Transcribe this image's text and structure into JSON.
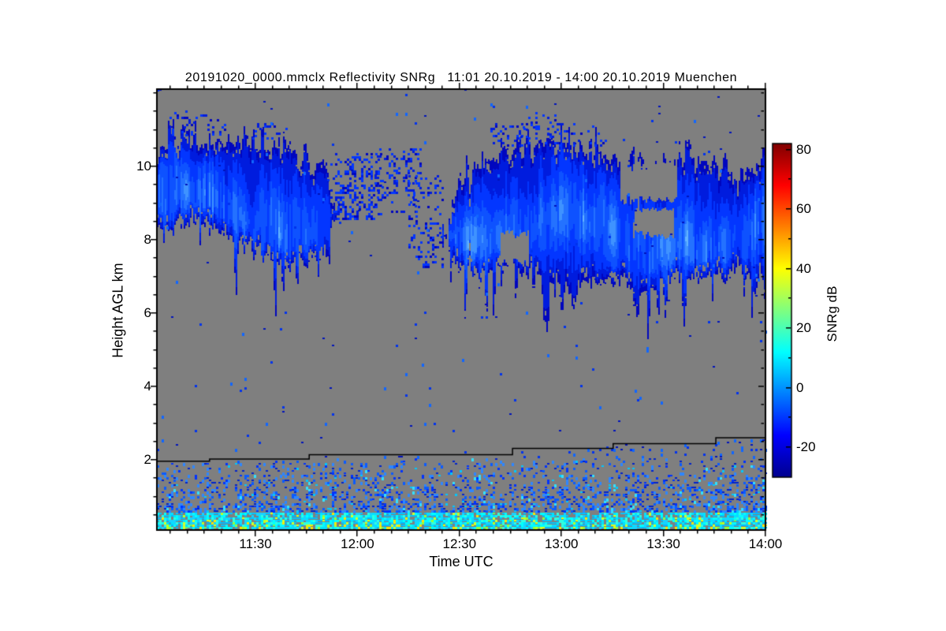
{
  "chart_data": {
    "type": "heatmap",
    "title": "20191020_0000.mmclx Reflectivity SNRg   11:01 20.10.2019 - 14:00 20.10.2019 Muenchen",
    "xlabel": "Time UTC",
    "ylabel": "Height AGL km",
    "x_axis": {
      "start_time": "11:01",
      "end_time": "14:00",
      "total_minutes": 179,
      "tick_labels": [
        "11:30",
        "12:00",
        "12:30",
        "13:00",
        "13:30",
        "14:00"
      ],
      "tick_minutes": [
        29,
        59,
        89,
        119,
        149,
        179
      ],
      "minor_tick_step_min": 5
    },
    "y_axis": {
      "range_km": [
        0.09,
        12.11
      ],
      "tick_labels": [
        "2",
        "4",
        "6",
        "8",
        "10"
      ],
      "tick_values_km": [
        2,
        4,
        6,
        8,
        10
      ],
      "minor_tick_step_km": 0.5
    },
    "colorbar": {
      "label": "SNRg dB",
      "range_db": [
        -30,
        82
      ],
      "tick_labels": [
        "80",
        "60",
        "40",
        "20",
        "0",
        "-20"
      ],
      "tick_values_db": [
        80,
        60,
        40,
        20,
        0,
        -20
      ],
      "minor_tick_step_db": 10,
      "colormap": "jet",
      "gradient_stops": [
        [
          "#800000",
          0.0
        ],
        [
          "#ff0000",
          0.125
        ],
        [
          "#ffff00",
          0.375
        ],
        [
          "#00ffff",
          0.625
        ],
        [
          "#0000ff",
          0.875
        ],
        [
          "#00008f",
          1.0
        ]
      ]
    },
    "no_data_color": "#7f7f7f",
    "frame_color": "#000000",
    "cloud_palette": [
      "#0006BE",
      "#001CDE",
      "#0336FF",
      "#0E52FF",
      "#2472FF",
      "#3F93FF",
      "#63B4FF",
      "#86CFFF",
      "#A3E2FF"
    ],
    "cloud_bands": [
      {
        "name": "upper-cloud-mass-left",
        "t": [
          0,
          8,
          18,
          27,
          36,
          46,
          53
        ],
        "top_km": [
          10.3,
          10.9,
          10.6,
          10.8,
          10.6,
          10.1,
          9.9
        ],
        "bot_km": [
          8.4,
          8.5,
          8.3,
          7.8,
          7.3,
          7.4,
          8.0
        ],
        "core_km": [
          9.3,
          9.4,
          9.0,
          8.3,
          8.2,
          8.2,
          8.8
        ],
        "intensity": [
          0.9,
          0.95,
          0.8,
          0.9,
          0.95,
          0.8,
          0.45
        ]
      },
      {
        "name": "upper-cloud-mass-right",
        "t": [
          84,
          95,
          105,
          115,
          125,
          135,
          145,
          155,
          165,
          172,
          179
        ],
        "top_km": [
          9.3,
          10.0,
          10.6,
          10.6,
          10.5,
          10.3,
          9.9,
          10.2,
          10.0,
          9.7,
          9.9
        ],
        "bot_km": [
          7.3,
          7.2,
          7.4,
          7.0,
          6.9,
          6.8,
          6.7,
          7.1,
          7.0,
          7.3,
          7.0
        ],
        "core_km": [
          8.1,
          8.0,
          8.2,
          8.6,
          8.9,
          8.3,
          7.6,
          8.0,
          7.6,
          8.2,
          8.6
        ],
        "intensity": [
          0.75,
          0.9,
          0.85,
          0.8,
          0.95,
          0.85,
          0.8,
          0.9,
          0.9,
          0.7,
          0.8
        ]
      }
    ],
    "debris_patches": [
      {
        "t0": 51,
        "t1": 66,
        "h0": 8.6,
        "h1": 10.4,
        "density": 0.3
      },
      {
        "t0": 64,
        "t1": 78,
        "h0": 8.8,
        "h1": 10.5,
        "density": 0.22
      },
      {
        "t0": 74,
        "t1": 84,
        "h0": 7.3,
        "h1": 9.8,
        "density": 0.15
      },
      {
        "t0": 3,
        "t1": 20,
        "h0": 10.9,
        "h1": 11.5,
        "density": 0.12
      },
      {
        "t0": 28,
        "t1": 40,
        "h0": 10.8,
        "h1": 11.3,
        "density": 0.15
      },
      {
        "t0": 98,
        "t1": 132,
        "h0": 10.6,
        "h1": 11.2,
        "density": 0.15
      },
      {
        "t0": 107,
        "t1": 118,
        "h0": 10.7,
        "h1": 11.6,
        "density": 0.1
      }
    ],
    "holes": [
      {
        "t0": 136,
        "t1": 153,
        "h0": 9.1,
        "h1": 10.05
      },
      {
        "t0": 140,
        "t1": 152,
        "h0": 8.15,
        "h1": 8.85
      },
      {
        "t0": 101,
        "t1": 109,
        "h0": 7.4,
        "h1": 8.2
      }
    ],
    "surface_noise": {
      "dense_band_top_km": 0.62,
      "sparse_top_km": 2.0,
      "dense_colors": [
        "#00C8FF",
        "#00BBFF",
        "#00E4FF",
        "#00FFFF",
        "#2FFFE0",
        "#18D2FF"
      ],
      "accent_green": [
        "#69FF5A",
        "#96FF38",
        "#C0FF20"
      ],
      "accent_yellow": [
        "#E4FF0C",
        "#FFE400",
        "#D2FF2A"
      ],
      "speckle_blues": [
        "#0022CC",
        "#0033FF",
        "#0B5BFF",
        "#2E86FF"
      ],
      "speckle_cyan": [
        "#00C8FF",
        "#33E0FF"
      ],
      "stray_colors": [
        "#0013BB",
        "#0032EE",
        "#1166FF"
      ]
    },
    "range_step_line": {
      "color": "#000000",
      "t_min": [
        0,
        15.5,
        15.5,
        44.8,
        44.8,
        104.6,
        104.6,
        134.2,
        134.2,
        164.4,
        164.4,
        179
      ],
      "height_km": [
        1.96,
        1.96,
        2.02,
        2.02,
        2.14,
        2.14,
        2.31,
        2.31,
        2.44,
        2.44,
        2.6,
        2.6
      ]
    }
  }
}
